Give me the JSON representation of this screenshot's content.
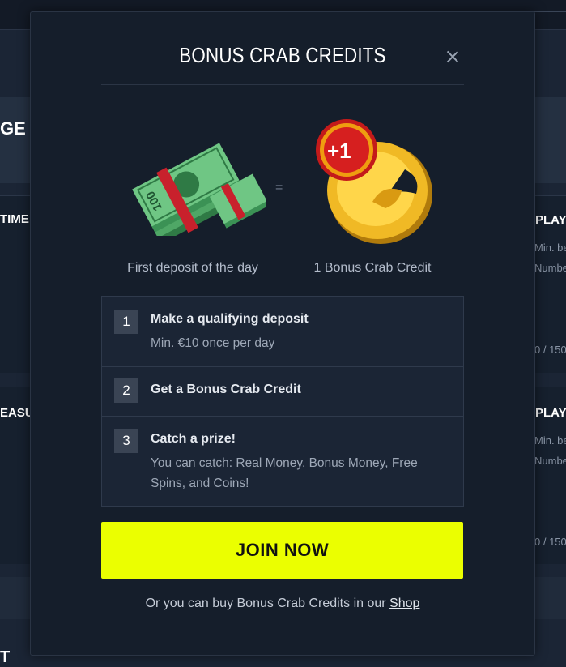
{
  "background": {
    "labels": [
      "GE",
      "TIME",
      "EASUR",
      "PLAY",
      "PLAY",
      "T"
    ],
    "small_text": [
      "Min. be",
      "Numbe",
      "0 / 150",
      "Min. be",
      "Numbe",
      "0 / 150"
    ]
  },
  "modal": {
    "title": "BONUS CRAB CREDITS",
    "close_icon": "close-icon",
    "equals_symbol": "=",
    "left_caption": "First deposit of the day",
    "right_caption": "1 Bonus Crab Credit",
    "coin_badge": "+1",
    "money_label": "100",
    "steps": [
      {
        "number": "1",
        "title": "Make a qualifying deposit",
        "subtitle": "Min. €10 once per day"
      },
      {
        "number": "2",
        "title": "Get a Bonus Crab Credit",
        "subtitle": ""
      },
      {
        "number": "3",
        "title": "Catch a prize!",
        "subtitle": "You can catch: Real Money, Bonus Money, Free Spins, and Coins!"
      }
    ],
    "join_button": "JOIN NOW",
    "footer_prefix": "Or you can buy Bonus Crab Credits in our",
    "shop_link": "Shop"
  },
  "colors": {
    "accent": "#ebff00",
    "modal_bg": "#151e2b",
    "page_bg": "#1b2535"
  }
}
